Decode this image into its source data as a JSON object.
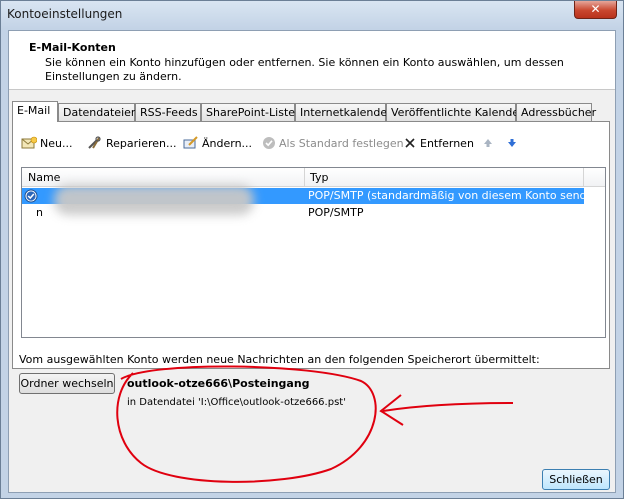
{
  "window": {
    "title": "Kontoeinstellungen",
    "close_glyph": "✕"
  },
  "header": {
    "title": "E-Mail-Konten",
    "description": "Sie können ein Konto hinzufügen oder entfernen. Sie können ein Konto auswählen, um dessen Einstellungen zu ändern."
  },
  "tabs": [
    {
      "label": "E-Mail",
      "active": true
    },
    {
      "label": "Datendateien"
    },
    {
      "label": "RSS-Feeds"
    },
    {
      "label": "SharePoint-Listen"
    },
    {
      "label": "Internetkalender"
    },
    {
      "label": "Veröffentlichte Kalender"
    },
    {
      "label": "Adressbücher"
    }
  ],
  "toolbar": {
    "new": "Neu...",
    "repair": "Reparieren...",
    "change": "Ändern...",
    "set_default": "Als Standard festlegen",
    "remove": "Entfernen",
    "up_icon": "arrow-up-icon",
    "down_icon": "arrow-down-icon"
  },
  "list": {
    "columns": [
      "Name",
      "Typ"
    ],
    "rows": [
      {
        "name": "",
        "type": "POP/SMTP (standardmäßig von diesem Konto senden)",
        "selected": true,
        "default": true
      },
      {
        "name": "n",
        "type": "POP/SMTP",
        "selected": false
      }
    ]
  },
  "delivery": {
    "info": "Vom ausgewählten Konto werden neue Nachrichten an den folgenden Speicherort übermittelt:",
    "change_folder_button": "Ordner wechseln",
    "store_name": "outlook-otze666\\Posteingang",
    "store_file": "in Datendatei 'I:\\Office\\outlook-otze666.pst'"
  },
  "footer": {
    "close_button": "Schließen"
  },
  "colors": {
    "selection": "#3399ff",
    "annotation": "#e0000f",
    "title_bar": "#c3d3e6"
  }
}
